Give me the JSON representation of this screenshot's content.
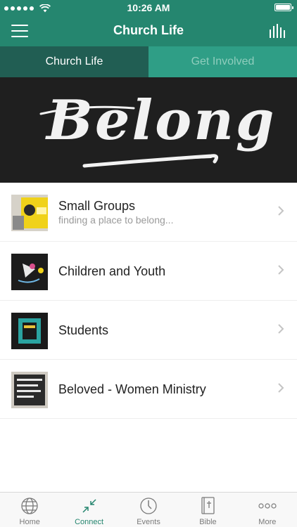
{
  "status_bar": {
    "time": "10:26 AM"
  },
  "nav": {
    "title": "Church Life"
  },
  "tabs": [
    {
      "label": "Church Life",
      "active": true
    },
    {
      "label": "Get Involved",
      "active": false
    }
  ],
  "banner": {
    "text": "Belong"
  },
  "list": [
    {
      "title": "Small Groups",
      "subtitle": "finding a place to belong..."
    },
    {
      "title": "Children and Youth"
    },
    {
      "title": "Students"
    },
    {
      "title": "Beloved - Women Ministry"
    }
  ],
  "tab_bar": [
    {
      "label": "Home",
      "icon": "globe-icon"
    },
    {
      "label": "Connect",
      "icon": "connect-arrows-icon",
      "active": true
    },
    {
      "label": "Events",
      "icon": "clock-icon"
    },
    {
      "label": "Bible",
      "icon": "bible-icon"
    },
    {
      "label": "More",
      "icon": "more-dots-icon"
    }
  ],
  "colors": {
    "brand": "#25866f",
    "tab_active": "#215e53",
    "tab_inactive": "#2f9e86"
  }
}
